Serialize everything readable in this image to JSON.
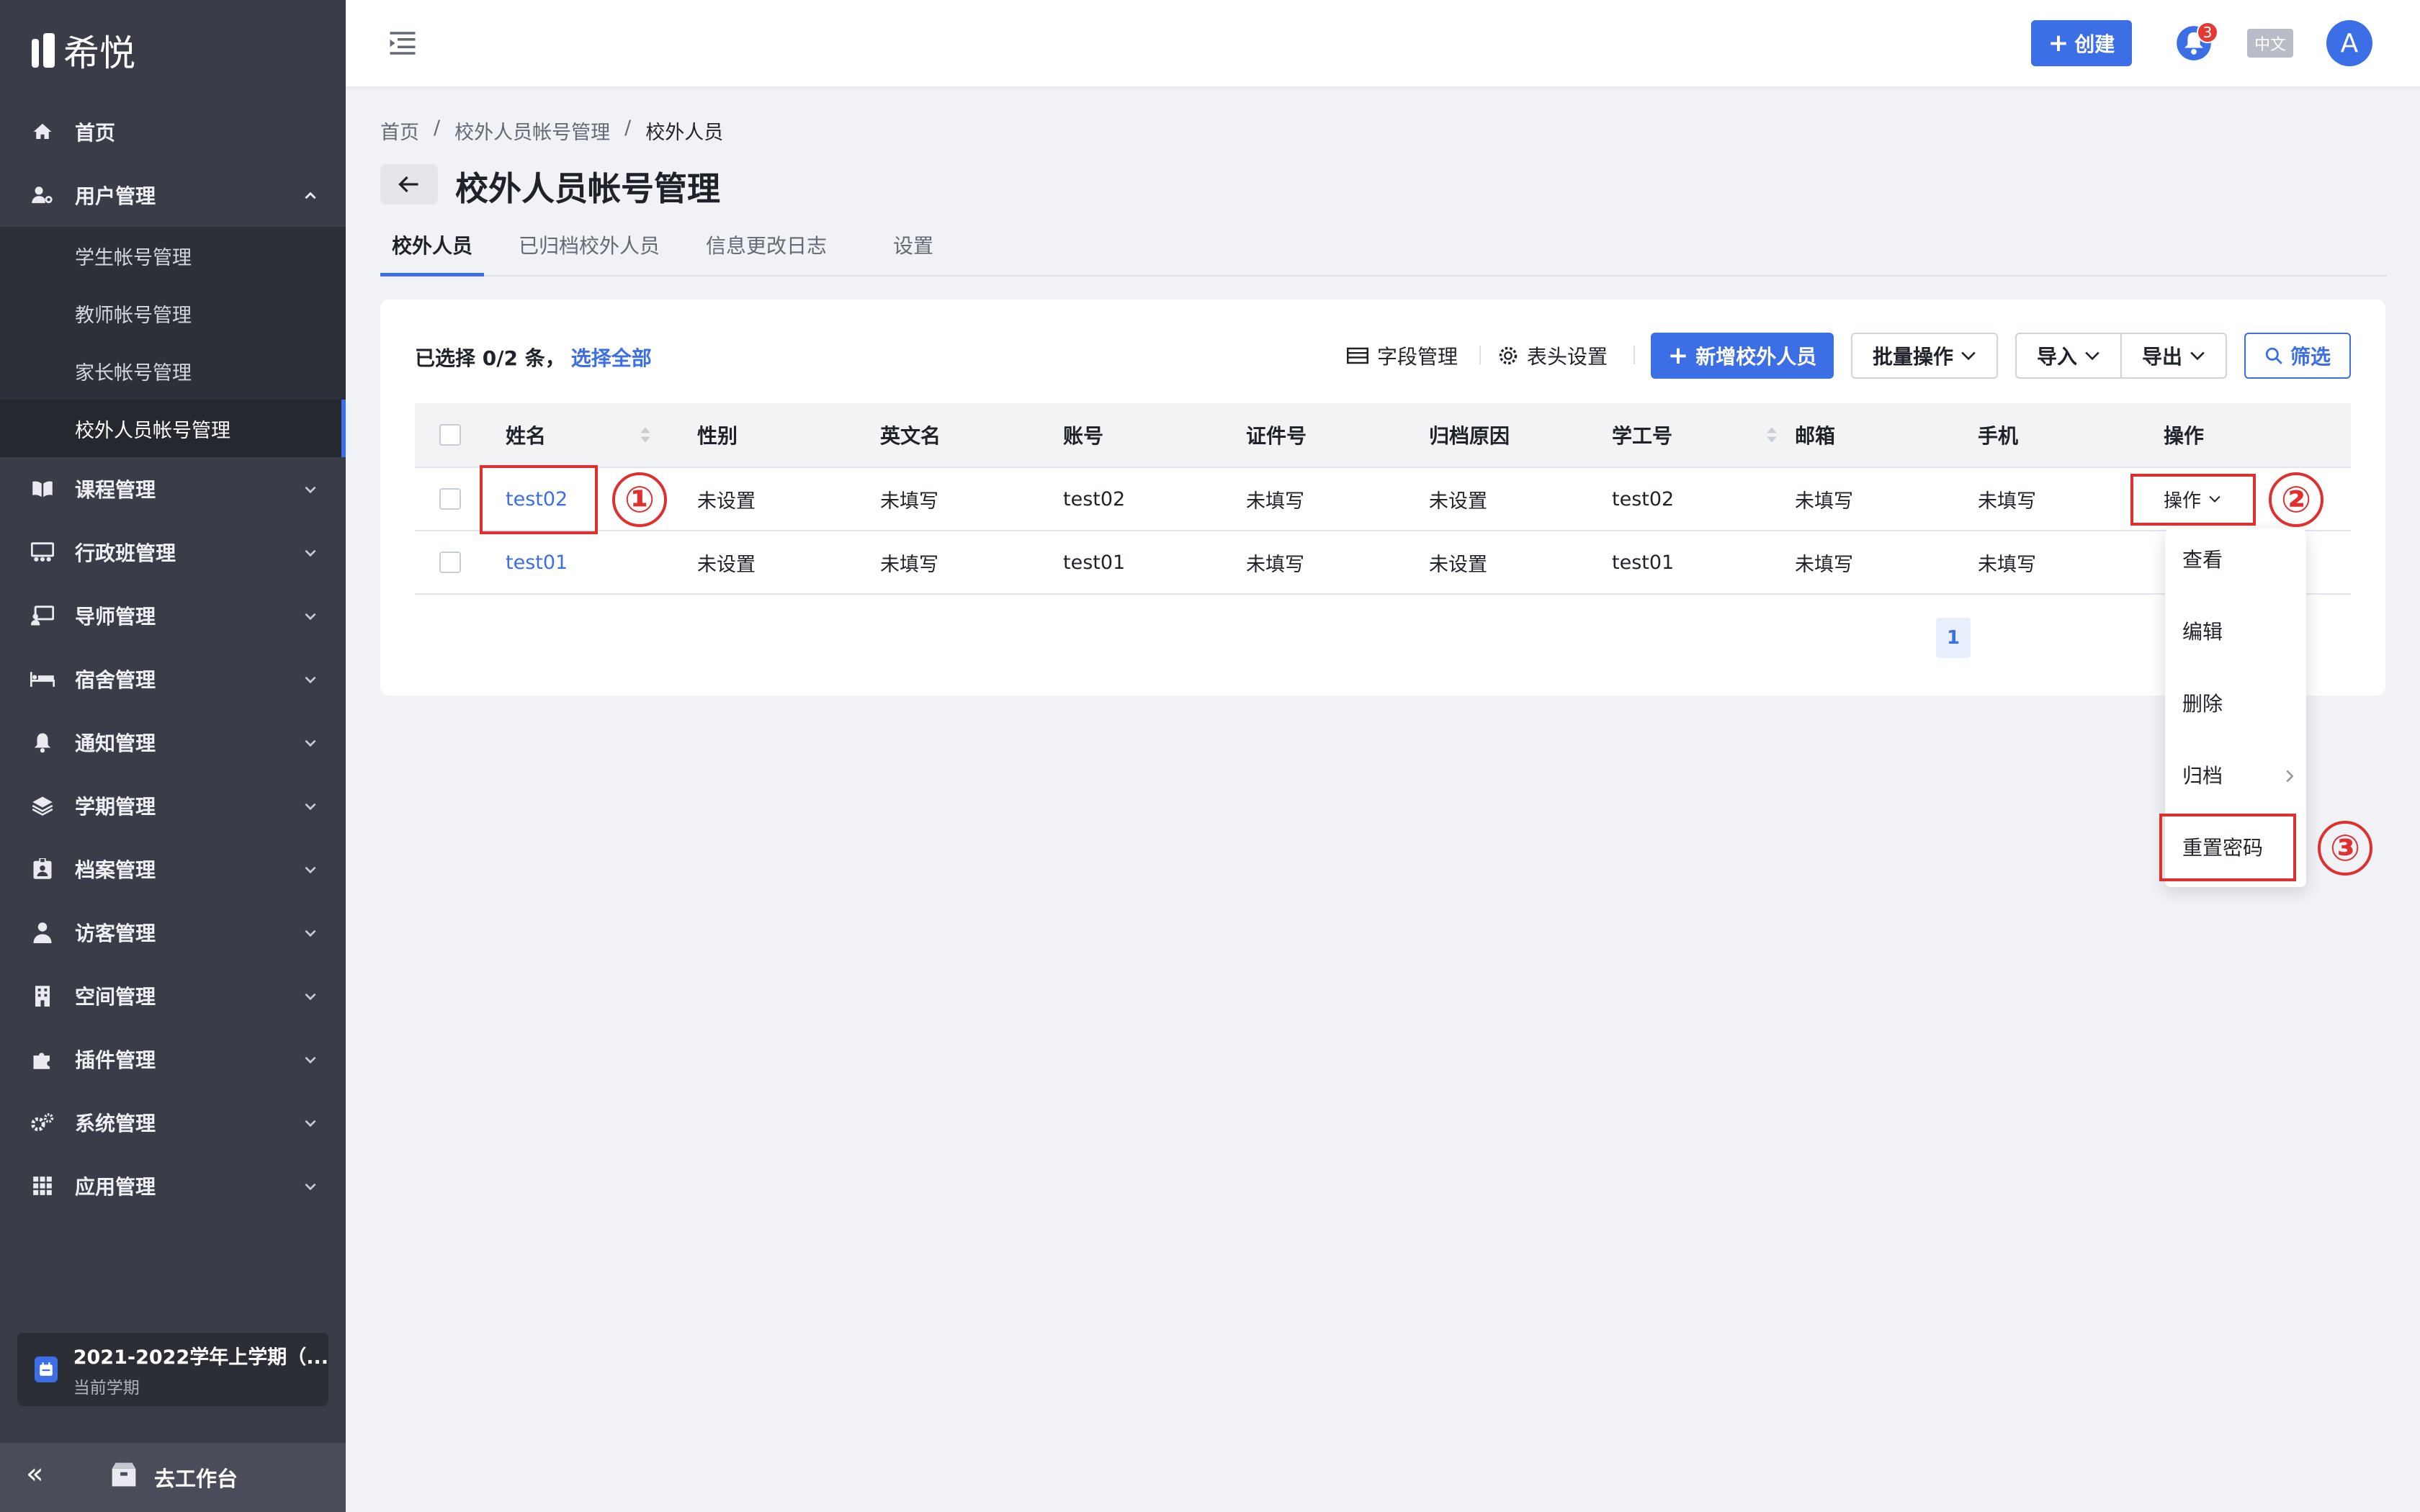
{
  "app": {
    "name": "希悦"
  },
  "sidebar": {
    "items": [
      {
        "label": "首页",
        "icon": "home-icon"
      },
      {
        "label": "用户管理",
        "icon": "user-gear-icon",
        "expanded": true,
        "children": [
          "学生帐号管理",
          "教师帐号管理",
          "家长帐号管理",
          "校外人员帐号管理"
        ],
        "active_child": 3
      },
      {
        "label": "课程管理",
        "icon": "book-icon"
      },
      {
        "label": "行政班管理",
        "icon": "class-icon"
      },
      {
        "label": "导师管理",
        "icon": "mentor-icon"
      },
      {
        "label": "宿舍管理",
        "icon": "bed-icon"
      },
      {
        "label": "通知管理",
        "icon": "bell-icon"
      },
      {
        "label": "学期管理",
        "icon": "layers-icon"
      },
      {
        "label": "档案管理",
        "icon": "id-badge-icon"
      },
      {
        "label": "访客管理",
        "icon": "visitor-icon"
      },
      {
        "label": "空间管理",
        "icon": "building-icon"
      },
      {
        "label": "插件管理",
        "icon": "puzzle-icon"
      },
      {
        "label": "系统管理",
        "icon": "gears-icon"
      },
      {
        "label": "应用管理",
        "icon": "apps-icon"
      }
    ],
    "term": {
      "title": "2021-2022学年上学期（...",
      "subtitle": "当前学期"
    },
    "collapse": "«",
    "workbench": "去工作台"
  },
  "topbar": {
    "create": "创建",
    "notifications": "3",
    "lang": "中文",
    "avatar": "A"
  },
  "breadcrumb": [
    "首页",
    "校外人员帐号管理",
    "校外人员"
  ],
  "breadcrumb_sep": "/",
  "page": {
    "title": "校外人员帐号管理"
  },
  "tabs": [
    "校外人员",
    "已归档校外人员",
    "信息更改日志",
    "设置"
  ],
  "toolbar": {
    "selected_prefix": "已选择 0/2 条，",
    "select_all": "选择全部",
    "field_manage": "字段管理",
    "header_settings": "表头设置",
    "add": "新增校外人员",
    "batch": "批量操作",
    "import": "导入",
    "export": "导出",
    "filter": "筛选"
  },
  "table": {
    "columns": [
      "姓名",
      "性别",
      "英文名",
      "账号",
      "证件号",
      "归档原因",
      "学工号",
      "邮箱",
      "手机",
      "操作"
    ],
    "rows": [
      [
        "test02",
        "未设置",
        "未填写",
        "test02",
        "未填写",
        "未设置",
        "test02",
        "未填写",
        "未填写",
        "操作"
      ],
      [
        "test01",
        "未设置",
        "未填写",
        "test01",
        "未填写",
        "未设置",
        "test01",
        "未填写",
        "未填写",
        ""
      ]
    ]
  },
  "pagination": {
    "current": "1"
  },
  "dropdown": [
    "查看",
    "编辑",
    "删除",
    "归档",
    "重置密码"
  ],
  "annotations": [
    "①",
    "②",
    "③"
  ],
  "colors": {
    "primary": "#3c6ee6",
    "sidebar": "#3a3d48",
    "annotation": "#e02f2f"
  }
}
